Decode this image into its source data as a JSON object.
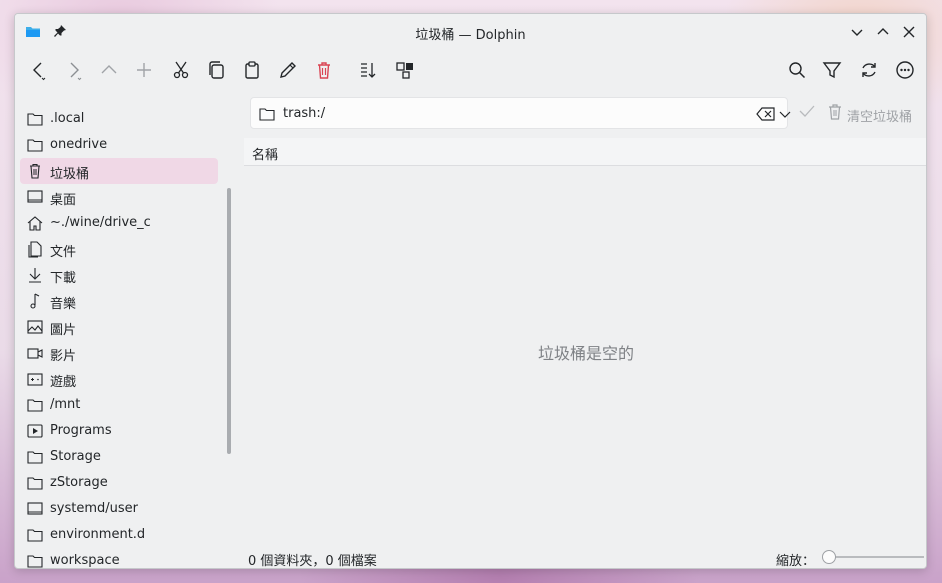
{
  "window": {
    "title": "垃圾桶 — Dolphin"
  },
  "titlebar": {
    "left_icons": [
      "folder-app-icon",
      "pin-icon"
    ],
    "controls": [
      "minimize-chevron-down-icon",
      "maximize-chevron-up-icon",
      "close-icon"
    ]
  },
  "toolbar": {
    "left": [
      "back-icon",
      "forward-icon",
      "up-icon",
      "new-tab-plus-icon",
      "cut-icon",
      "copy-icon",
      "paste-icon",
      "rename-pencil-icon",
      "delete-trash-icon",
      "sort-icon",
      "split-view-icon"
    ],
    "right": [
      "search-icon",
      "filter-icon",
      "refresh-icon",
      "menu-more-icon"
    ],
    "accent_delete_color": "#da4453"
  },
  "sidebar": {
    "items": [
      {
        "label": ".local",
        "icon": "folder-icon"
      },
      {
        "label": "onedrive",
        "icon": "folder-icon"
      },
      {
        "label": "垃圾桶",
        "icon": "trash-icon",
        "active": true
      },
      {
        "label": "桌面",
        "icon": "desktop-icon"
      },
      {
        "label": "~./wine/drive_c",
        "icon": "home-icon"
      },
      {
        "label": "文件",
        "icon": "documents-icon"
      },
      {
        "label": "下載",
        "icon": "download-icon"
      },
      {
        "label": "音樂",
        "icon": "music-icon"
      },
      {
        "label": "圖片",
        "icon": "pictures-icon"
      },
      {
        "label": "影片",
        "icon": "videos-icon"
      },
      {
        "label": "遊戲",
        "icon": "games-icon"
      },
      {
        "label": "/mnt",
        "icon": "folder-icon"
      },
      {
        "label": "Programs",
        "icon": "programs-icon"
      },
      {
        "label": "Storage",
        "icon": "folder-icon"
      },
      {
        "label": "zStorage",
        "icon": "folder-icon"
      },
      {
        "label": "systemd/user",
        "icon": "desktop-icon"
      },
      {
        "label": "environment.d",
        "icon": "folder-icon"
      },
      {
        "label": "workspace",
        "icon": "folder-icon"
      }
    ],
    "active_color": "#f0d8e6"
  },
  "location": {
    "path": "trash:/"
  },
  "actions": {
    "empty_trash_label": "清空垃圾桶"
  },
  "columns": {
    "name": "名稱"
  },
  "content": {
    "empty_message": "垃圾桶是空的"
  },
  "status": {
    "summary": "0 個資料夾，0 個檔案",
    "zoom_label": "縮放："
  }
}
